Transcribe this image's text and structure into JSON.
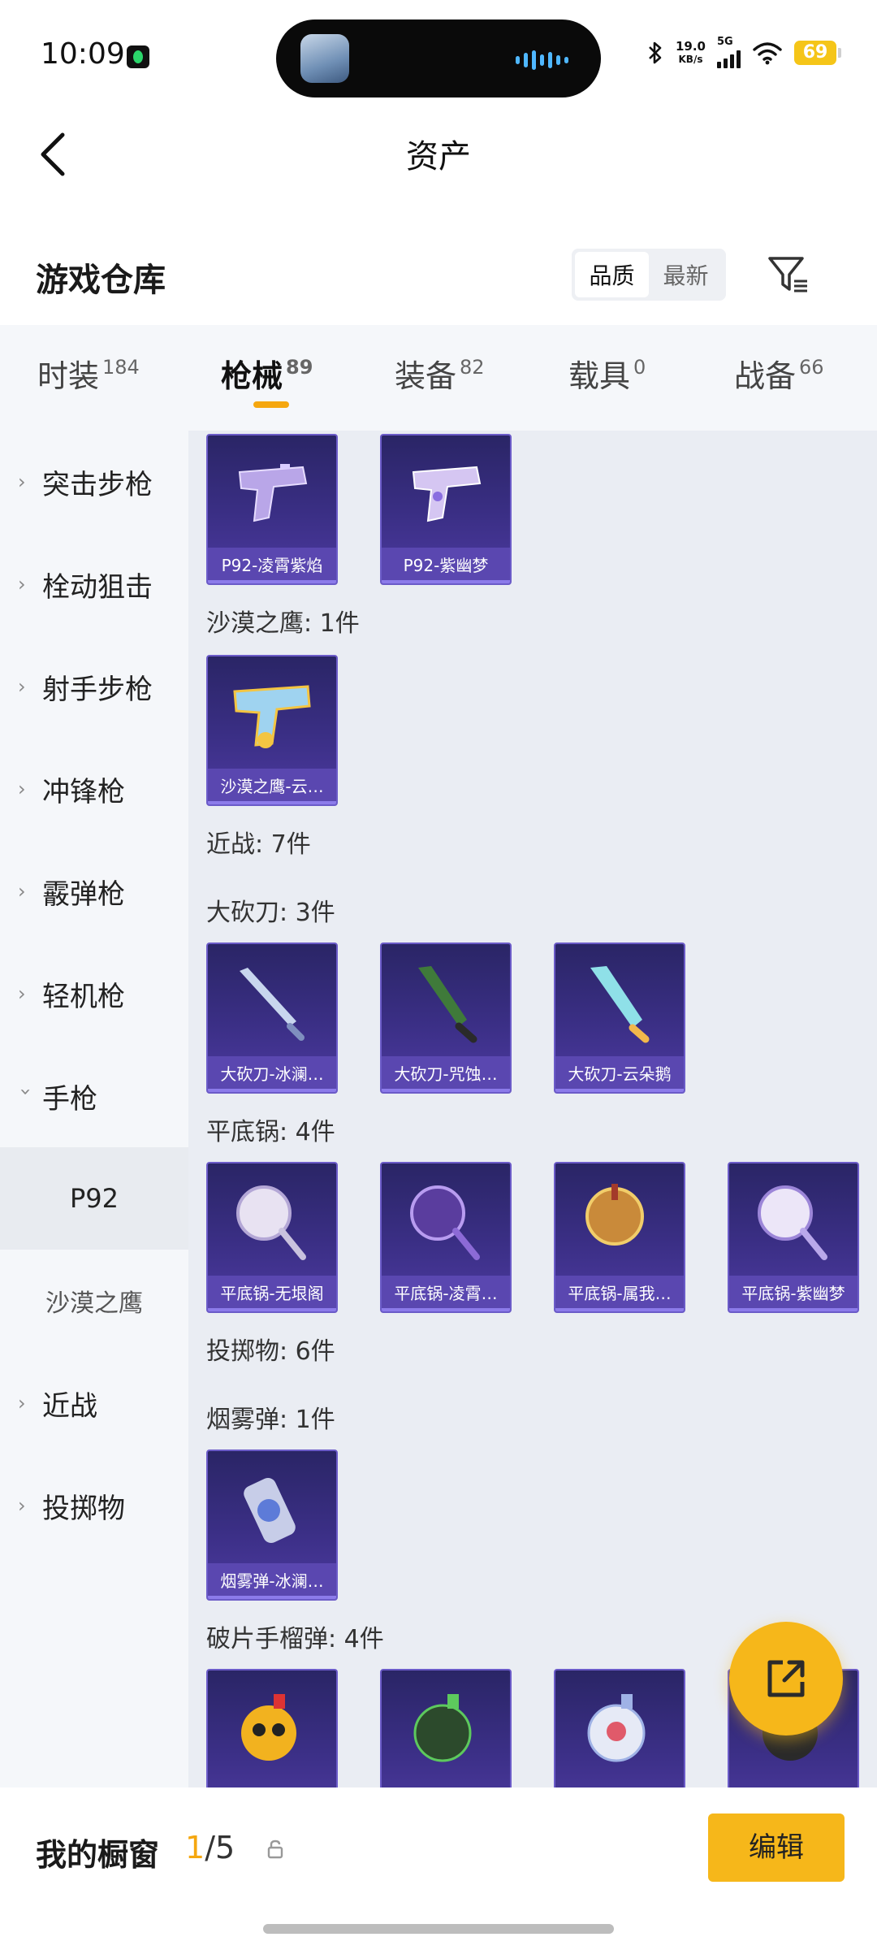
{
  "status_bar": {
    "time": "10:09",
    "speed_value": "19.0",
    "speed_unit": "KB/s",
    "network": "5G",
    "battery": "69"
  },
  "nav": {
    "title": "资产"
  },
  "header": {
    "title": "游戏仓库",
    "sort_options": [
      "品质",
      "最新"
    ],
    "active_sort": "品质"
  },
  "tabs": [
    {
      "label": "时装",
      "count": "184"
    },
    {
      "label": "枪械",
      "count": "89",
      "active": true
    },
    {
      "label": "装备",
      "count": "82"
    },
    {
      "label": "载具",
      "count": "0"
    },
    {
      "label": "战备",
      "count": "66"
    }
  ],
  "sidebar": {
    "items": [
      {
        "label": "突击步枪"
      },
      {
        "label": "栓动狙击"
      },
      {
        "label": "射手步枪"
      },
      {
        "label": "冲锋枪"
      },
      {
        "label": "霰弹枪"
      },
      {
        "label": "轻机枪"
      },
      {
        "label": "手枪",
        "expanded": true
      },
      {
        "label": "P92",
        "selected": true
      },
      {
        "label": "沙漠之鹰"
      },
      {
        "label": "近战"
      },
      {
        "label": "投掷物"
      }
    ]
  },
  "content": {
    "labels": {
      "desert_eagle": "沙漠之鹰: 1件",
      "melee": "近战: 7件",
      "machete": "大砍刀: 3件",
      "pan": "平底锅: 4件",
      "throwables": "投掷物: 6件",
      "smoke": "烟雾弹: 1件",
      "frag": "破片手榴弹: 4件"
    },
    "cards": {
      "p92_1": "P92-凌霄紫焰",
      "p92_2": "P92-紫幽梦",
      "deagle_1": "沙漠之鹰-云…",
      "machete_1": "大砍刀-冰澜…",
      "machete_2": "大砍刀-咒蚀…",
      "machete_3": "大砍刀-云朵鹅",
      "pan_1": "平底锅-无垠阁",
      "pan_2": "平底锅-凌霄…",
      "pan_3": "平底锅-属我…",
      "pan_4": "平底锅-紫幽梦",
      "smoke_1": "烟雾弹-冰澜…"
    }
  },
  "footer": {
    "title": "我的橱窗",
    "count_current": "1",
    "count_total": "/5",
    "edit_label": "编辑"
  },
  "colors": {
    "accent": "#f6b71a",
    "card_bg": "#3b2f86",
    "card_label": "#5a47b0",
    "content_bg": "#eaedf3",
    "sidebar_bg": "#f5f7fa"
  }
}
